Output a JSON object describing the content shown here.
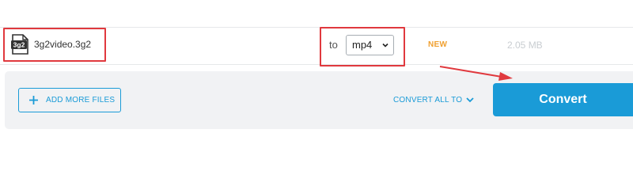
{
  "file": {
    "icon": "3g2-file-icon",
    "icon_text": "3g2",
    "name": "3g2video.3g2",
    "to_label": "to",
    "format_selected": "mp4",
    "status": "NEW",
    "size": "2.05 MB"
  },
  "actions": {
    "add_more_label": "ADD MORE FILES",
    "convert_all_label": "CONVERT ALL TO",
    "convert_label": "Convert"
  },
  "annotations": {
    "highlight_color": "#e0393e"
  },
  "colors": {
    "accent": "#1a9bd7",
    "status_new": "#f0a030",
    "bar_background": "#f1f2f4"
  }
}
